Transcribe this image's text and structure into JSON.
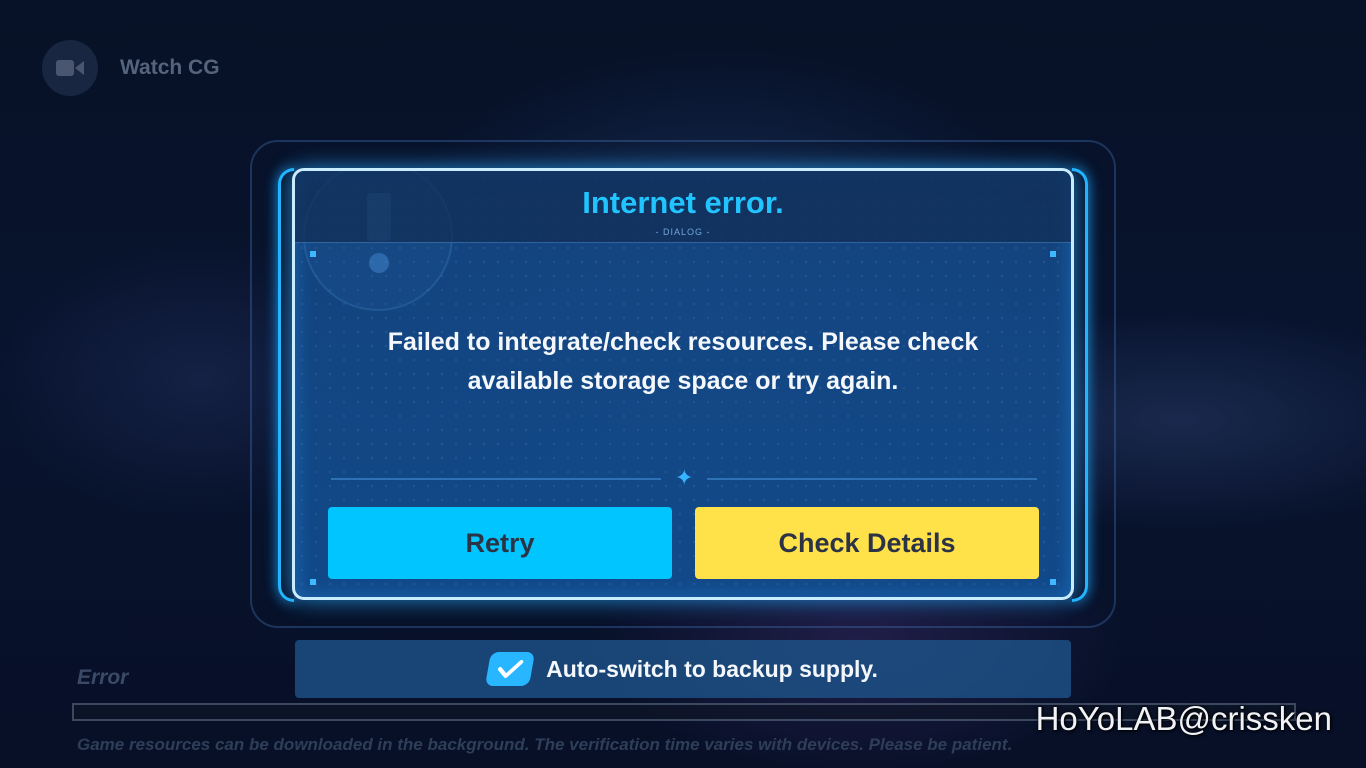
{
  "top_left": {
    "watch_label": "Watch CG",
    "icon": "video-camera-icon"
  },
  "dialog": {
    "title": "Internet error.",
    "subtitle": "- DIALOG -",
    "message": "Failed to integrate/check resources. Please check available storage space or try again.",
    "retry_label": "Retry",
    "check_details_label": "Check Details"
  },
  "auto_switch": {
    "label": "Auto-switch to backup supply.",
    "checked": true
  },
  "status": {
    "label": "Error",
    "progress": 0.0,
    "note": "Game resources can be downloaded in the background. The verification time varies with devices. Please be patient."
  },
  "watermark": "HoYoLAB@crissken",
  "colors": {
    "accent_blue": "#22c4ff",
    "retry_button": "#00c5ff",
    "check_button": "#ffe14a"
  }
}
